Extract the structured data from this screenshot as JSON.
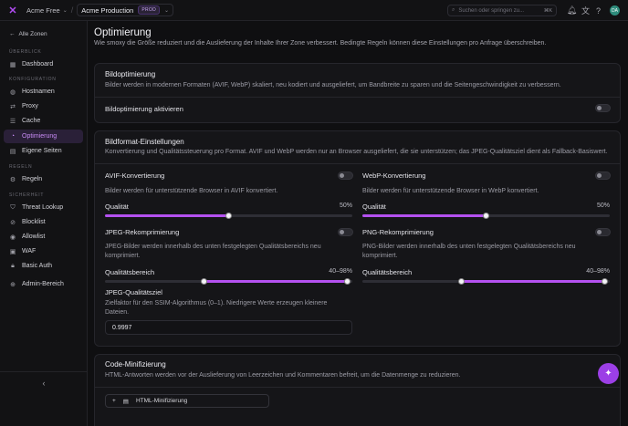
{
  "topbar": {
    "org": "Acme Free",
    "project": "Acme Production",
    "project_badge": "PROD",
    "search_placeholder": "Suchen oder springen zu...",
    "search_shortcut": "⌘K",
    "avatar_initials": "DA"
  },
  "sidebar": {
    "back_label": "Alle Zonen",
    "sections": {
      "overview": "ÜBERBLICK",
      "config": "KONFIGURATION",
      "rules": "REGELN",
      "security": "SICHERHEIT"
    },
    "items": {
      "dashboard": "Dashboard",
      "hostnames": "Hostnamen",
      "proxy": "Proxy",
      "cache": "Cache",
      "optimization": "Optimierung",
      "pages": "Eigene Seiten",
      "rules": "Regeln",
      "threat": "Threat Lookup",
      "blocklist": "Blocklist",
      "allowlist": "Allowlist",
      "waf": "WAF",
      "basicauth": "Basic Auth",
      "admin": "Admin-Bereich"
    }
  },
  "page": {
    "title": "Optimierung",
    "subtitle": "Wie smoxy die Größe reduziert und die Auslieferung der Inhalte Ihrer Zone verbessert. Bedingte Regeln können diese Einstellungen pro Anfrage überschreiben."
  },
  "image_opt": {
    "title": "Bildoptimierung",
    "description": "Bilder werden in modernen Formaten (AVIF, WebP) skaliert, neu kodiert und ausgeliefert, um Bandbreite zu sparen und die Seitengeschwindigkeit zu verbessern.",
    "toggle_label": "Bildoptimierung aktivieren",
    "enabled": false
  },
  "format": {
    "title": "Bildformat-Einstellungen",
    "description": "Konvertierung und Qualitätssteuerung pro Format. AVIF und WebP werden nur an Browser ausgeliefert, die sie unterstützen; das JPEG-Qualitätsziel dient als Fallback-Basiswert.",
    "avif_label": "AVIF-Konvertierung",
    "avif_desc": "Bilder werden für unterstützende Browser in AVIF konvertiert.",
    "webp_label": "WebP-Konvertierung",
    "webp_desc": "Bilder werden für unterstützende Browser in WebP konvertiert.",
    "quality_label": "Qualität",
    "avif_quality": "50%",
    "webp_quality": "50%",
    "avif_quality_value": 50,
    "webp_quality_value": 50,
    "jpeg_label": "JPEG-Rekomprimierung",
    "jpeg_desc": "JPEG-Bilder werden innerhalb des unten festgelegten Qualitätsbereichs neu komprimiert.",
    "png_label": "PNG-Rekomprimierung",
    "png_desc": "PNG-Bilder werden innerhalb des unten festgelegten Qualitätsbereichs neu komprimiert.",
    "range_label": "Qualitätsbereich",
    "jpeg_range": "40–98%",
    "png_range": "40–98%",
    "range_min": 40,
    "range_max": 98,
    "target_label": "JPEG-Qualitätsziel",
    "target_desc": "Zielfaktor für den SSIM-Algorithmus (0–1). Niedrigere Werte erzeugen kleinere Dateien.",
    "target_value": "0.9997"
  },
  "minify": {
    "title": "Code-Minifizierung",
    "description": "HTML-Antworten werden vor der Auslieferung von Leerzeichen und Kommentaren befreit, um die Datenmenge zu reduzieren.",
    "html_label": "HTML-Minifizierung"
  },
  "colors": {
    "accent": "#b451f0",
    "active_bg": "#2a2038"
  }
}
